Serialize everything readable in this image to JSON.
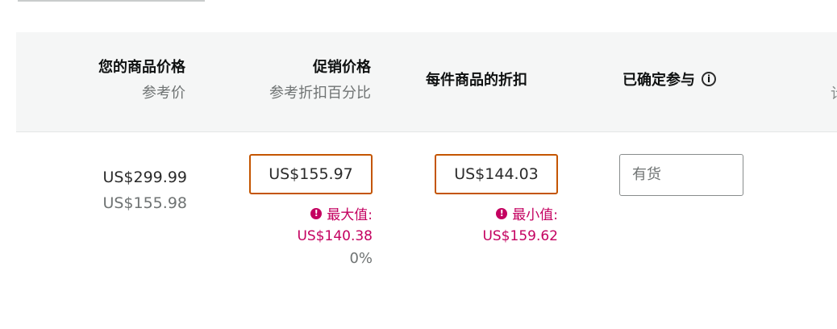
{
  "header": {
    "your_price": {
      "title": "您的商品价格",
      "subtitle": "参考价"
    },
    "promo_price": {
      "title": "促销价格",
      "subtitle": "参考折扣百分比"
    },
    "discount_per_unit": {
      "title": "每件商品的折扣"
    },
    "confirmed": {
      "title": "已确定参与",
      "info_icon": "info-icon"
    },
    "cutoff_glyph": "计"
  },
  "row": {
    "your_price": "US$299.99",
    "reference_price": "US$155.98",
    "promo_price_value": "US$155.97",
    "promo_error_label": "最大值:",
    "promo_error_value": "US$140.38",
    "promo_percent": "0%",
    "discount_value": "US$144.03",
    "discount_error_label": "最小值:",
    "discount_error_value": "US$159.62",
    "confirmed_placeholder": "有货"
  },
  "colors": {
    "error": "#c40060",
    "invalid_border": "#c45500",
    "header_bg": "#f5f6f6"
  }
}
